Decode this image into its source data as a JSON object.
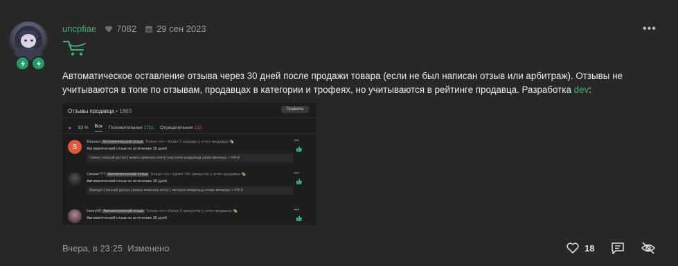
{
  "post": {
    "username": "uncpfiae",
    "likes_count": "7082",
    "date": "29 сен 2023",
    "more_label": "•••",
    "text_main": "Автоматическое оставление отзыва через 30 дней после продажи товара (если не был написан отзыв или арбитраж). Отзывы не учитываются в топе по отзывам, продавцах в категории и трофеях, но учитываются в рейтинге продавца. Разработка ",
    "text_link": "dev",
    "text_tail": ":",
    "footer_time": "Вчера, в 23:25",
    "footer_edited": "Изменено",
    "reaction_count": "18"
  },
  "screenshot": {
    "title": "Отзывы продавца",
    "title_dot": "•",
    "count": "1863",
    "rules_button": "Правила",
    "rating": "93 %",
    "tab_all": "Все",
    "tab_positive": "Положительные",
    "tab_positive_count": "1731",
    "tab_negative": "Отрицательные",
    "tab_negative_count": "132",
    "reviews": [
      {
        "avatar_letter": "S",
        "name": "Mooooo",
        "tag": "Автоматический отзыв",
        "meta": "Только что • Купил 2 секунды у этого продавца 🎭",
        "text": "Автоматический отзыв по истечению 30 дней",
        "details": "Скины | полный доступ | можно изменить почту | настоите владельца слове-фильтры >  640 ₽",
        "avatar_color": "#e2573a"
      },
      {
        "avatar_letter": "",
        "name": "Cesaar777",
        "tag": "Автоматический отзыв",
        "meta": "Только что • Купил 240 аккаунтов у этого продавца 🎭",
        "text": "Автоматический отзыв по истечению 30 дней",
        "details": "Фанкуро | полный доступ | можно изменить почту | настоите владельца слове-фильтры >  476 ₽",
        "avatar_color": "#3a3a3a"
      },
      {
        "avatar_letter": "",
        "name": "Henry09",
        "tag": "Автоматический отзыв",
        "meta": "Только что • Купил 5 аккаунтов у этого продавца 🎭",
        "text": "Автоматический отзыв по истечению 30 дней",
        "details": "",
        "avatar_color": "#7a5a6a"
      }
    ]
  },
  "colors": {
    "accent": "#3bb16f",
    "background": "#272727",
    "negative": "#d24b4b"
  },
  "icons": [
    "heart-icon",
    "calendar-icon",
    "cart-icon",
    "more-icon",
    "heart-outline-icon",
    "comment-icon",
    "eye-off-icon",
    "lightning-icon",
    "thumb-up-icon"
  ]
}
